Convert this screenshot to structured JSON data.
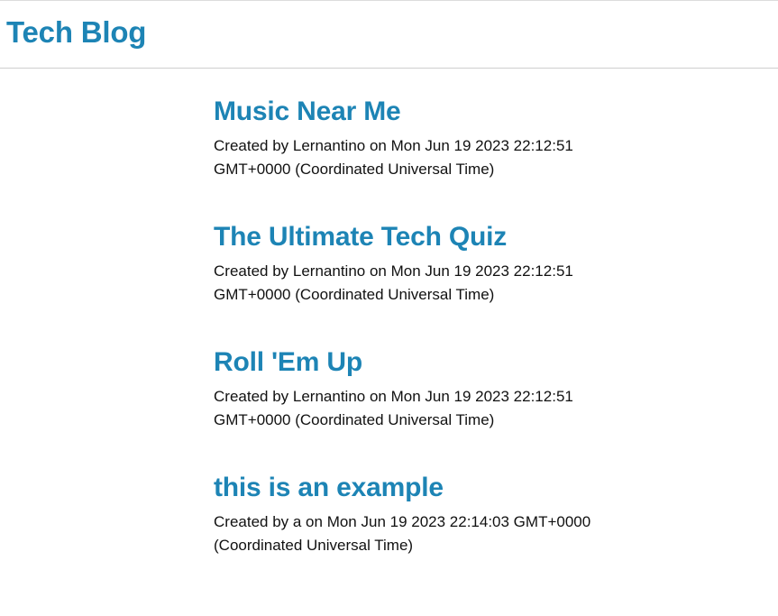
{
  "header": {
    "site_title": "Tech Blog"
  },
  "posts": [
    {
      "title": "Music Near Me",
      "meta": "Created by Lernantino on Mon Jun 19 2023 22:12:51 GMT+0000 (Coordinated Universal Time)"
    },
    {
      "title": "The Ultimate Tech Quiz",
      "meta": "Created by Lernantino on Mon Jun 19 2023 22:12:51 GMT+0000 (Coordinated Universal Time)"
    },
    {
      "title": "Roll 'Em Up",
      "meta": "Created by Lernantino on Mon Jun 19 2023 22:12:51 GMT+0000 (Coordinated Universal Time)"
    },
    {
      "title": "this is an example",
      "meta": "Created by a on Mon Jun 19 2023 22:14:03 GMT+0000 (Coordinated Universal Time)"
    }
  ],
  "colors": {
    "accent": "#1d84b5",
    "text": "#111111",
    "divider": "#cfcfcf"
  }
}
